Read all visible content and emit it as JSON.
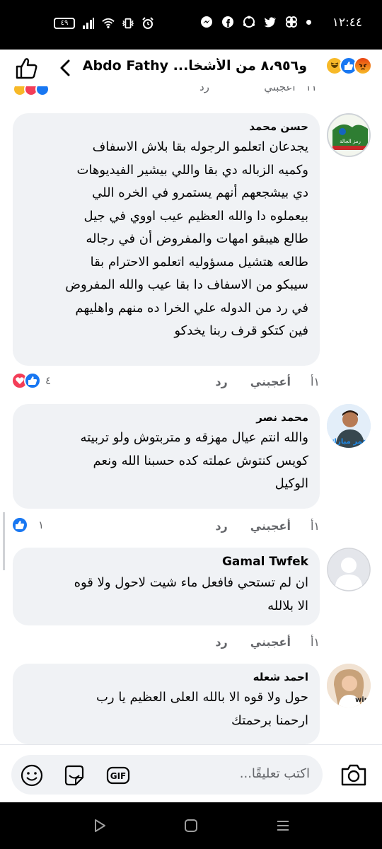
{
  "status_bar": {
    "time": "١٢:٤٤",
    "battery": "٤٩"
  },
  "header": {
    "title": "و٨،٩٥٦ من الأشخا... Abdo Fathy",
    "reactions": [
      "haha",
      "like",
      "angry"
    ]
  },
  "partial_row": {
    "time": "١١",
    "like_label": "أعجبني",
    "reply_label": "رد"
  },
  "comments": [
    {
      "author": "حسن محمد",
      "lines": [
        "يجدعان اتعلمو الرجوله بقا بلاش الاسفاف",
        "وكميه الزباله دي بقا واللي بيشير الفيديوهات",
        "دي بيشجعهم أنهم يستمرو في الخره اللي",
        "بيعملوه دا والله العظيم عيب اووي في جيل",
        "طالع هيبقو امهات والمفروض أن في رجاله",
        "طالعه هتشيل مسؤوليه اتعلمو الاحترام بقا",
        "سيبكو من الاسفاف دا بقا عيب والله المفروض",
        "في رد من الدوله علي الخرا ده منهم واهليهم",
        "فين كتكو قرف ربنا يخدكو"
      ],
      "time": "١أ",
      "like_label": "أعجبني",
      "reply_label": "رد",
      "reaction_count": "٤",
      "reactions": [
        "like",
        "love"
      ]
    },
    {
      "author": "محمد نصر",
      "lines": [
        "والله انتم عيال مهزقه و متربتوش ولو تربيته",
        "كويس كنتوش عملته كده حسبنا الله ونعم",
        "الوكيل"
      ],
      "time": "١أ",
      "like_label": "أعجبني",
      "reply_label": "رد",
      "reaction_count": "١",
      "reactions": [
        "like"
      ]
    },
    {
      "author": "Gamal Twfek",
      "lines": [
        "ان لم تستحي فافعل ماء شيت لاحول ولا قوه",
        "الا بلالله"
      ],
      "time": "١أ",
      "like_label": "أعجبني",
      "reply_label": "رد"
    },
    {
      "author": "احمد شعله",
      "lines": [
        "حول ولا قوه الا بالله  العلى  العظيم يا رب",
        "ارحمنا برحمتك"
      ]
    }
  ],
  "composer": {
    "placeholder": "اكتب تعليقًا...",
    "gif_label": "GIF"
  },
  "avatar_texts": {
    "c1": "رمز الجالة",
    "c2": "عمر مبارك"
  }
}
